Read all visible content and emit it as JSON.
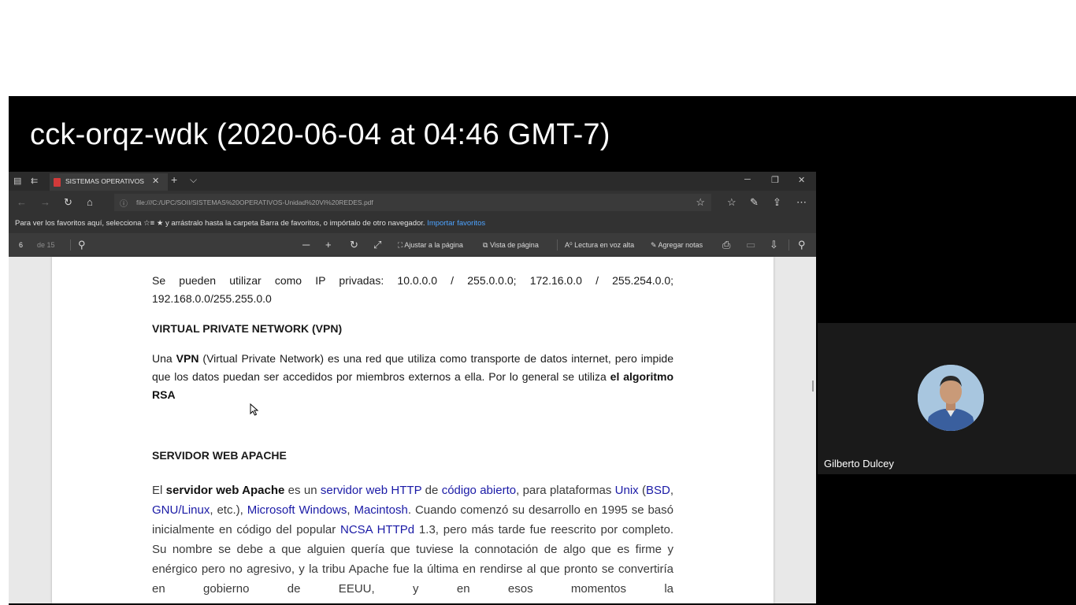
{
  "meeting": {
    "title": "cck-orqz-wdk (2020-06-04 at 04:46 GMT-7)",
    "participant_name": "Gilberto Dulcey"
  },
  "browser": {
    "tab_label": "SISTEMAS OPERATIVOS",
    "tab_close": "✕",
    "new_tab": "+",
    "tab_list": "⌵",
    "address": "file:///C:/UPC/SOII/SISTEMAS%20OPERATIVOS-Unidad%20VI%20REDES.pdf",
    "favorites_message": "Para ver los favoritos aquí, selecciona ☆≡ ★ y arrástralo hasta la carpeta Barra de favoritos, o impórtalo de otro navegador.",
    "import_favorites_link": "Importar favoritos"
  },
  "pdf_toolbar": {
    "page_current": "6",
    "page_total": "de 15",
    "fit_page": "Ajustar a la página",
    "page_view": "Vista de página",
    "read_aloud": "Lectura en voz alta",
    "add_notes": "Agregar notas"
  },
  "document": {
    "private_ip_text": "Se pueden utilizar como IP privadas: 10.0.0.0 / 255.0.0.0; 172.16.0.0 / 255.254.0.0; 192.168.0.0/255.255.0.0",
    "vpn_heading": "VIRTUAL PRIVATE NETWORK (VPN)",
    "vpn_1": "Una ",
    "vpn_2": "VPN",
    "vpn_3": " (Virtual Private Network) es una red que utiliza como transporte de datos internet, pero impide que los datos puedan ser accedidos por miembros externos a ella. Por lo general se utiliza ",
    "vpn_4": "el algoritmo RSA",
    "apache_heading": "SERVIDOR WEB APACHE",
    "ap_01": "El ",
    "ap_02": "servidor web Apache",
    "ap_03": " es un ",
    "ap_04": "servidor web",
    "ap_05": " ",
    "ap_06": "HTTP",
    "ap_07": " de ",
    "ap_08": "código abierto",
    "ap_09": ", para plataformas ",
    "ap_10": "Unix",
    "ap_11": " (",
    "ap_12": "BSD",
    "ap_13": ", ",
    "ap_14": "GNU/Linux",
    "ap_15": ", etc.), ",
    "ap_16": "Microsoft Windows",
    "ap_17": ", ",
    "ap_18": "Macintosh",
    "ap_19": ". Cuando comenzó su desarrollo en 1995 se basó inicialmente en código del popular ",
    "ap_20": "NCSA HTTPd",
    "ap_21": " 1.3, pero más tarde fue reescrito por completo. Su nombre se debe a que alguien quería que tuviese la connotación de algo que es firme y enérgico pero no agresivo, y la tribu Apache fue la última en rendirse al que pronto se convertiría en gobierno de EEUU, y en esos momentos la"
  },
  "colors": {
    "browser_chrome": "#2b2b2b",
    "link_blue": "#1a1aa6",
    "favorites_link": "#4da3ff",
    "pdf_icon_red": "#d23a3a"
  },
  "icons": [
    "tab-actions-icon",
    "tab-restore-icon",
    "pdf-file-icon",
    "back-icon",
    "forward-icon",
    "refresh-icon",
    "home-icon",
    "info-icon",
    "star-icon",
    "favorites-icon",
    "pen-icon",
    "share-icon",
    "more-icon",
    "search-icon",
    "zoom-out-icon",
    "zoom-in-icon",
    "rotate-icon",
    "fullscreen-icon",
    "print-icon",
    "save-icon",
    "save-as-icon",
    "pin-icon",
    "mouse-cursor-icon"
  ]
}
